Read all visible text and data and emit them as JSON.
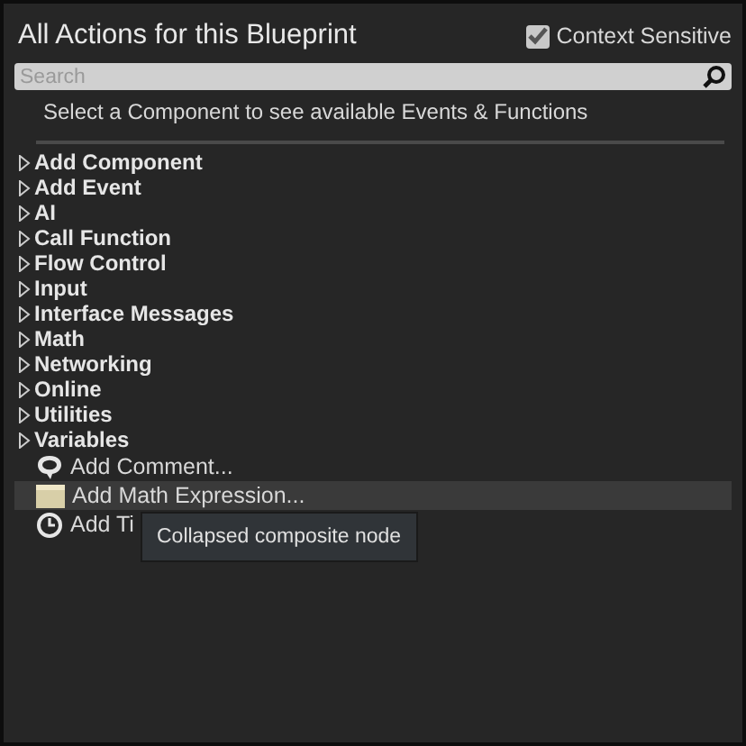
{
  "window": {
    "title": "All Actions for this Blueprint"
  },
  "context_sensitive": {
    "label": "Context Sensitive",
    "checked": true
  },
  "search": {
    "placeholder": "Search"
  },
  "hint": "Select a Component to see available Events & Functions",
  "categories": [
    {
      "label": "Add Component",
      "expanded": false
    },
    {
      "label": "Add Event",
      "expanded": false
    },
    {
      "label": "AI",
      "expanded": false
    },
    {
      "label": "Call Function",
      "expanded": false
    },
    {
      "label": "Flow Control",
      "expanded": false
    },
    {
      "label": "Input",
      "expanded": false
    },
    {
      "label": "Interface Messages",
      "expanded": false
    },
    {
      "label": "Math",
      "expanded": false
    },
    {
      "label": "Networking",
      "expanded": false
    },
    {
      "label": "Online",
      "expanded": false
    },
    {
      "label": "Utilities",
      "expanded": false
    },
    {
      "label": "Variables",
      "expanded": false
    }
  ],
  "actions": [
    {
      "kind": "comment",
      "label": "Add Comment...",
      "hovered": false
    },
    {
      "kind": "math",
      "label": "Add Math Expression...",
      "hovered": true
    },
    {
      "kind": "timeline",
      "label": "Add Ti",
      "hovered": false
    }
  ],
  "tooltip": "Collapsed composite node"
}
